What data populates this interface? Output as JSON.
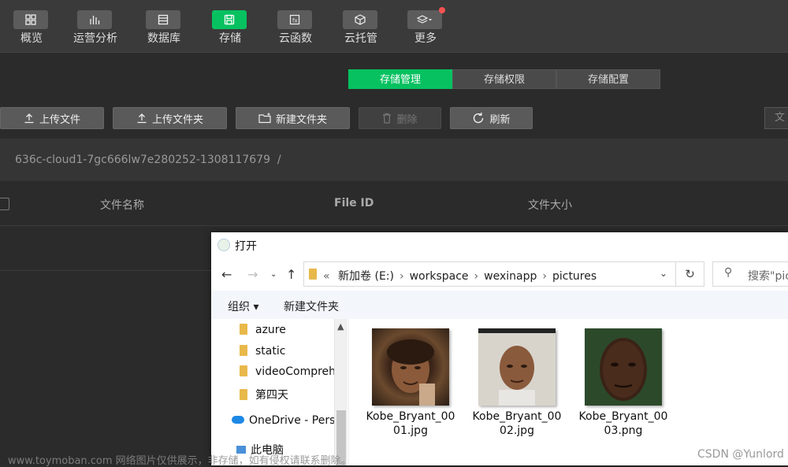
{
  "nav": {
    "items": [
      {
        "label": "概览",
        "icon": "grid-icon"
      },
      {
        "label": "运营分析",
        "icon": "bar-chart-icon"
      },
      {
        "label": "数据库",
        "icon": "database-icon"
      },
      {
        "label": "存储",
        "icon": "save-icon",
        "active": true
      },
      {
        "label": "云函数",
        "icon": "function-icon"
      },
      {
        "label": "云托管",
        "icon": "cube-icon"
      },
      {
        "label": "更多",
        "icon": "layers-icon",
        "badge": true
      }
    ]
  },
  "storage_tabs": [
    "存储管理",
    "存储权限",
    "存储配置"
  ],
  "toolbar": {
    "upload_file": "上传文件",
    "upload_folder": "上传文件夹",
    "new_folder": "新建文件夹",
    "delete": "删除",
    "refresh": "刷新",
    "search_stub": "文"
  },
  "path": {
    "bucket": "636c-cloud1-7gc666lw7e280252-1308117679",
    "sep": "/"
  },
  "table": {
    "headers": [
      "文件名称",
      "File ID",
      "文件大小"
    ]
  },
  "dialog": {
    "title": "打开",
    "address": {
      "prefix": "«",
      "crumbs": [
        "新加卷 (E:)",
        "workspace",
        "wexinapp",
        "pictures"
      ]
    },
    "search_placeholder": "搜索\"pic",
    "commands": {
      "organize": "组织 ▾",
      "new_folder": "新建文件夹"
    },
    "tree": [
      "azure",
      "static",
      "videoComprehe",
      "第四天"
    ],
    "onedrive": "OneDrive - Persc",
    "this_pc": "此电脑",
    "files": [
      {
        "name1": "Kobe_Bryant_00",
        "name2": "01.jpg"
      },
      {
        "name1": "Kobe_Bryant_00",
        "name2": "02.jpg"
      },
      {
        "name1": "Kobe_Bryant_00",
        "name2": "03.png"
      }
    ]
  },
  "watermark": "www.toymoban.com 网络图片仅供展示，非存储，如有侵权请联系删除。",
  "credit": "CSDN @Yunlord",
  "colors": {
    "accent": "#07c160",
    "badge": "#fa5151",
    "topbar": "#3a3a3a",
    "page": "#2b2b2b"
  }
}
